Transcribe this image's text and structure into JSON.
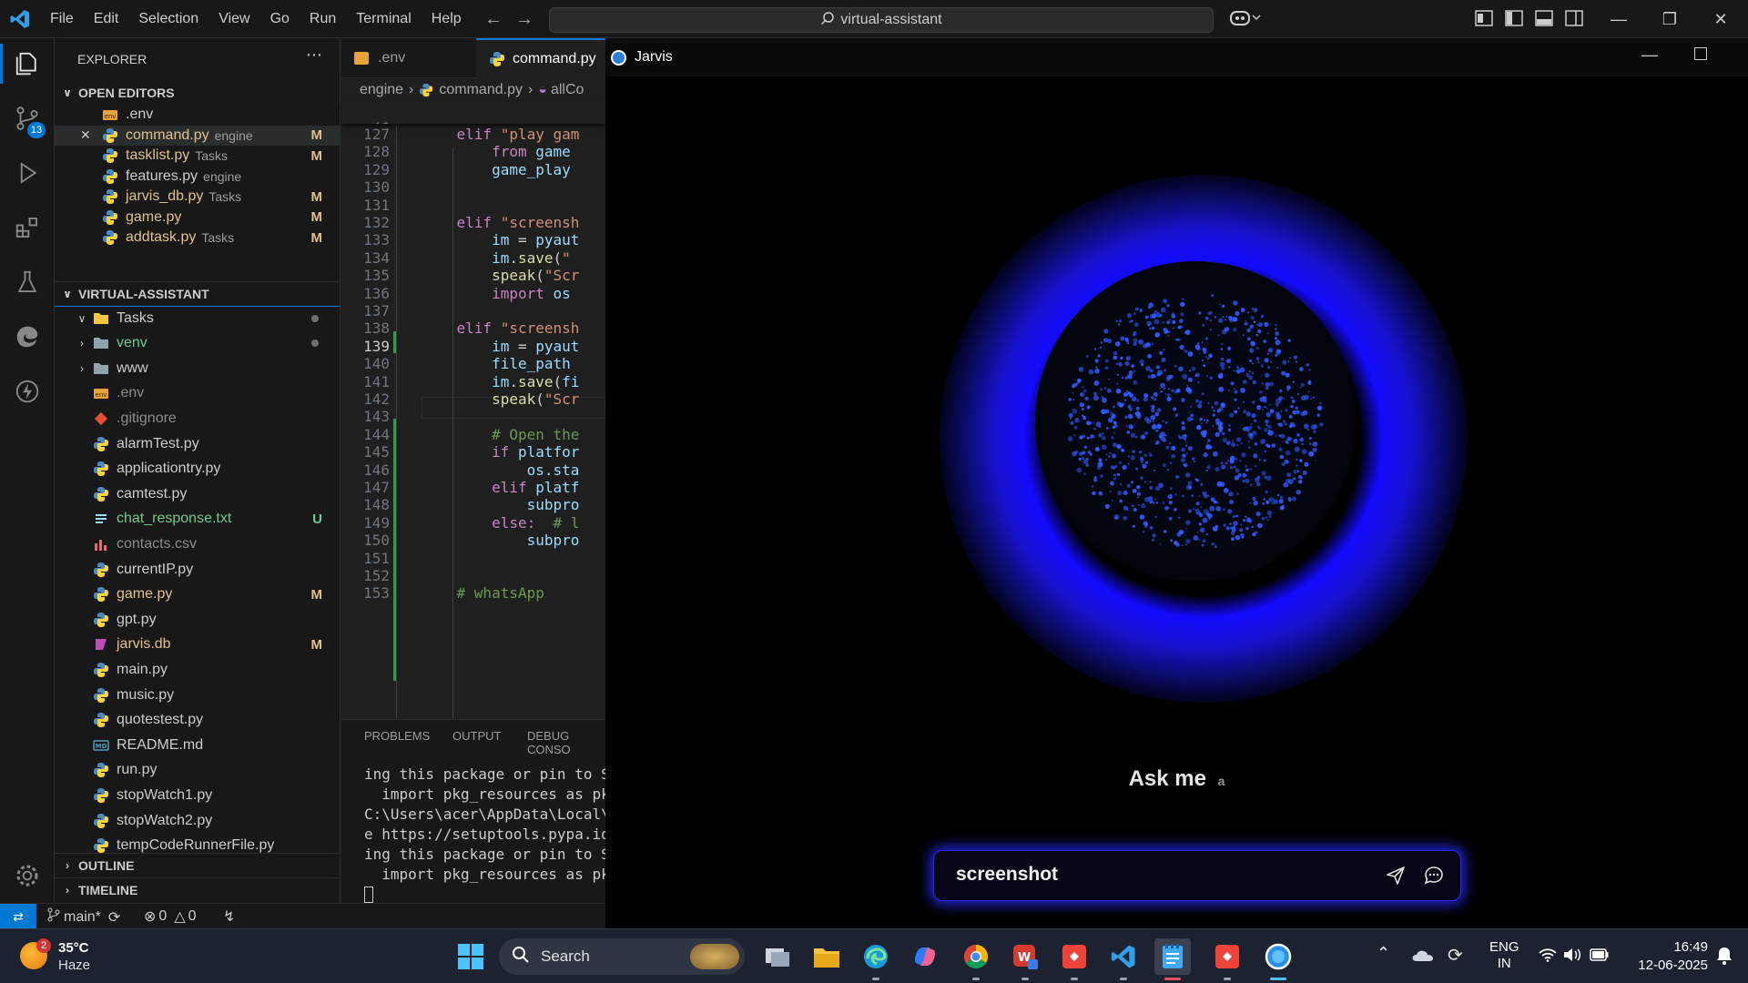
{
  "menu": [
    "File",
    "Edit",
    "Selection",
    "View",
    "Go",
    "Run",
    "Terminal",
    "Help"
  ],
  "search": {
    "text": "virtual-assistant"
  },
  "explorer": {
    "title": "EXPLORER",
    "open_editors_label": "OPEN EDITORS",
    "open_editors": [
      {
        "name": ".env",
        "desc": "",
        "badge": "",
        "icon": "env"
      },
      {
        "name": "command.py",
        "desc": "engine",
        "badge": "M",
        "icon": "python"
      },
      {
        "name": "tasklist.py",
        "desc": "Tasks",
        "badge": "M",
        "icon": "python"
      },
      {
        "name": "features.py",
        "desc": "engine",
        "badge": "",
        "icon": "python"
      },
      {
        "name": "jarvis_db.py",
        "desc": "Tasks",
        "badge": "M",
        "icon": "python"
      },
      {
        "name": "game.py",
        "desc": "",
        "badge": "M",
        "icon": "python"
      },
      {
        "name": "addtask.py",
        "desc": "Tasks",
        "badge": "M",
        "icon": "python"
      }
    ],
    "project_label": "VIRTUAL-ASSISTANT",
    "files": [
      {
        "name": "Tasks",
        "type": "folder-open",
        "badge": "dot"
      },
      {
        "name": "venv",
        "type": "folder",
        "badge": "dot"
      },
      {
        "name": "www",
        "type": "folder",
        "badge": ""
      },
      {
        "name": ".env",
        "type": "env",
        "badge": ""
      },
      {
        "name": ".gitignore",
        "type": "git",
        "badge": ""
      },
      {
        "name": "alarmTest.py",
        "type": "python",
        "badge": ""
      },
      {
        "name": "applicationtry.py",
        "type": "python",
        "badge": ""
      },
      {
        "name": "camtest.py",
        "type": "python",
        "badge": ""
      },
      {
        "name": "chat_response.txt",
        "type": "text",
        "badge": "U"
      },
      {
        "name": "contacts.csv",
        "type": "csv",
        "badge": ""
      },
      {
        "name": "currentIP.py",
        "type": "python",
        "badge": ""
      },
      {
        "name": "game.py",
        "type": "python",
        "badge": "M"
      },
      {
        "name": "gpt.py",
        "type": "python",
        "badge": ""
      },
      {
        "name": "jarvis.db",
        "type": "db",
        "badge": "M"
      },
      {
        "name": "main.py",
        "type": "python",
        "badge": ""
      },
      {
        "name": "music.py",
        "type": "python",
        "badge": ""
      },
      {
        "name": "quotestest.py",
        "type": "python",
        "badge": ""
      },
      {
        "name": "README.md",
        "type": "markdown",
        "badge": ""
      },
      {
        "name": "run.py",
        "type": "python",
        "badge": ""
      },
      {
        "name": "stopWatch1.py",
        "type": "python",
        "badge": ""
      },
      {
        "name": "stopWatch2.py",
        "type": "python",
        "badge": ""
      },
      {
        "name": "tempCodeRunnerFile.py",
        "type": "python",
        "badge": ""
      }
    ],
    "outline_label": "OUTLINE",
    "timeline_label": "TIMELINE"
  },
  "activity_badge": "13",
  "tabs": [
    ".env",
    "command.py"
  ],
  "breadcrumb": {
    "folder": "engine",
    "file": "command.py",
    "symbol": "allCo"
  },
  "sticky_line": {
    "num": "46",
    "code": "def allCommands(messag"
  },
  "code_lines": [
    {
      "num": "127",
      "code": "    elif \"play gam"
    },
    {
      "num": "128",
      "code": "        from game"
    },
    {
      "num": "129",
      "code": "        game_play"
    },
    {
      "num": "130",
      "code": ""
    },
    {
      "num": "131",
      "code": ""
    },
    {
      "num": "132",
      "code": "    elif \"screensh"
    },
    {
      "num": "133",
      "code": "        im = pyaut"
    },
    {
      "num": "134",
      "code": "        im.save(\""
    },
    {
      "num": "135",
      "code": "        speak(\"Scr"
    },
    {
      "num": "136",
      "code": "        import os"
    },
    {
      "num": "137",
      "code": ""
    },
    {
      "num": "138",
      "code": "    elif \"screensh"
    },
    {
      "num": "139",
      "code": "        im = pyaut"
    },
    {
      "num": "140",
      "code": "        file_path"
    },
    {
      "num": "141",
      "code": "        im.save(fi"
    },
    {
      "num": "142",
      "code": "        speak(\"Scr"
    },
    {
      "num": "143",
      "code": ""
    },
    {
      "num": "144",
      "code": "        # Open the"
    },
    {
      "num": "145",
      "code": "        if platfor"
    },
    {
      "num": "146",
      "code": "            os.sta"
    },
    {
      "num": "147",
      "code": "        elif platf"
    },
    {
      "num": "148",
      "code": "            subpro"
    },
    {
      "num": "149",
      "code": "        else:  # l"
    },
    {
      "num": "150",
      "code": "            subpro"
    },
    {
      "num": "151",
      "code": ""
    },
    {
      "num": "152",
      "code": ""
    },
    {
      "num": "153",
      "code": "    # whatsApp"
    }
  ],
  "panel": {
    "tabs": [
      "PROBLEMS",
      "OUTPUT",
      "DEBUG CONSO"
    ],
    "lines": [
      "ing this package or pin to Set",
      "  import pkg_resources as pkg",
      "C:\\Users\\acer\\AppData\\Local\\Pr",
      "e https://setuptools.pypa.io/e",
      "ing this package or pin to Set",
      "  import pkg_resources as pkg"
    ]
  },
  "status": {
    "branch": "main*",
    "errors": "0",
    "warnings": "0"
  },
  "jarvis": {
    "title": "Jarvis",
    "prompt": "Ask me",
    "prompt_trailing": "a",
    "input_value": "screenshot"
  },
  "taskbar": {
    "weather_temp": "35°C",
    "weather_desc": "Haze",
    "weather_badge": "2",
    "search_label": "Search",
    "lang_line1": "ENG",
    "lang_line2": "IN",
    "time": "16:49",
    "date": "12-06-2025"
  },
  "colors": {
    "modified": "#e2c08d",
    "untracked": "#73c991",
    "accent": "#0078d4",
    "orb_blue": "#1a14ff"
  }
}
